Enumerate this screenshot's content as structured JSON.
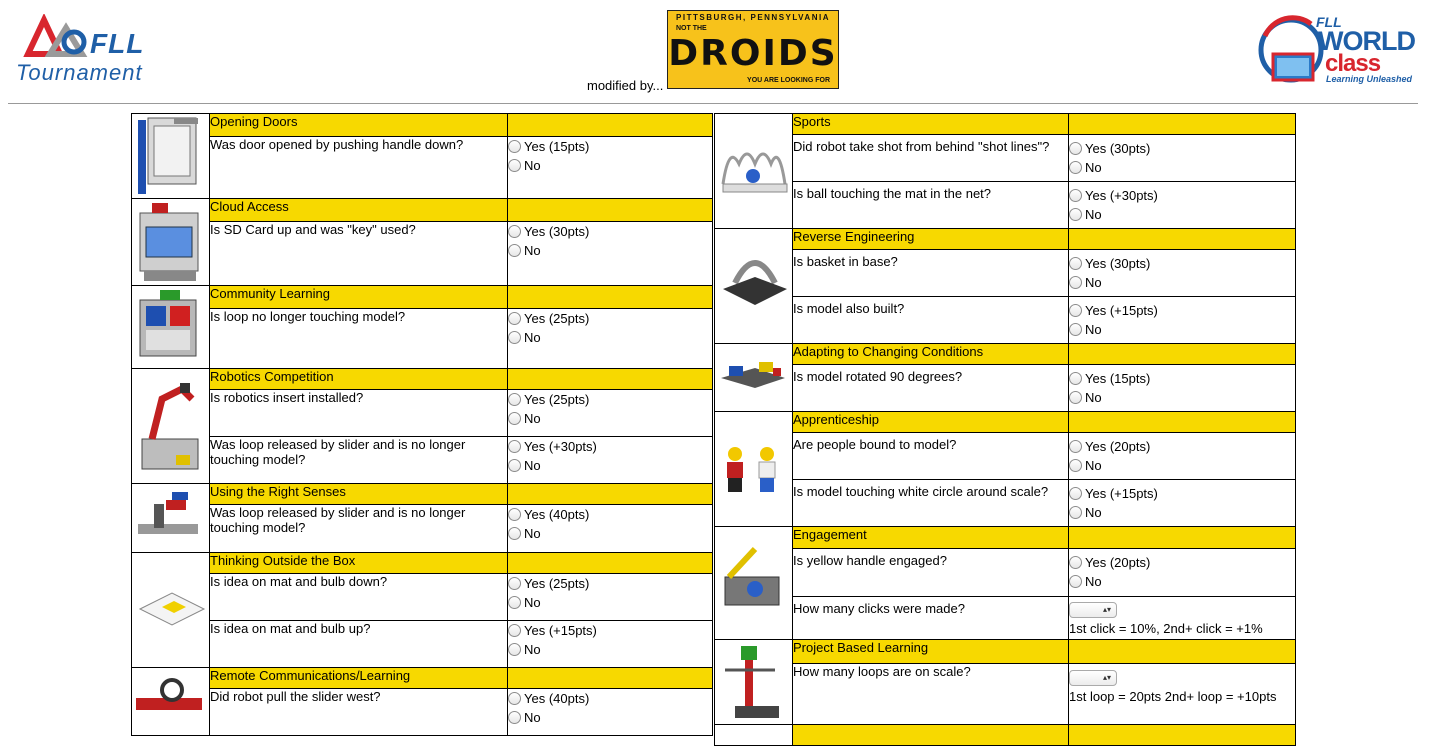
{
  "header": {
    "fll_logo_text": "FLL",
    "tournament_text": "Tournament",
    "modified_by": "modified by...",
    "droids": {
      "top_text": "PITTSBURGH, PENNSYLVANIA",
      "not_the": "NOT THE",
      "main_text": "DROIDS",
      "bottom_text": "YOU ARE LOOKING FOR"
    },
    "world_class": {
      "fll": "FLL",
      "world": "WORLD",
      "class": "class",
      "tagline": "Learning Unleashed"
    }
  },
  "left_missions": [
    {
      "title": "Opening Doors",
      "icon": "door-model-icon",
      "questions": [
        {
          "text": "Was door opened by pushing handle down?",
          "options": [
            "Yes (15pts)",
            "No"
          ]
        }
      ]
    },
    {
      "title": "Cloud Access",
      "icon": "cloud-access-model-icon",
      "questions": [
        {
          "text": "Is SD Card up and was \"key\" used?",
          "options": [
            "Yes (30pts)",
            "No"
          ]
        }
      ]
    },
    {
      "title": "Community Learning",
      "icon": "community-learning-model-icon",
      "questions": [
        {
          "text": "Is loop no longer touching model?",
          "options": [
            "Yes (25pts)",
            "No"
          ]
        }
      ]
    },
    {
      "title": "Robotics Competition",
      "icon": "robot-arm-model-icon",
      "questions": [
        {
          "text": "Is robotics insert installed?",
          "options": [
            "Yes (25pts)",
            "No"
          ]
        },
        {
          "text": "Was loop released by slider and is no longer touching model?",
          "options": [
            "Yes (+30pts)",
            "No"
          ]
        }
      ]
    },
    {
      "title": "Using the Right Senses",
      "icon": "senses-model-icon",
      "questions": [
        {
          "text": "Was loop released by slider and is no longer touching model?",
          "options": [
            "Yes (40pts)",
            "No"
          ]
        }
      ]
    },
    {
      "title": "Thinking Outside the Box",
      "icon": "box-model-icon",
      "questions": [
        {
          "text": "Is idea on mat and bulb down?",
          "options": [
            "Yes (25pts)",
            "No"
          ]
        },
        {
          "text": "Is idea on mat and bulb up?",
          "options": [
            "Yes (+15pts)",
            "No"
          ]
        }
      ]
    },
    {
      "title": "Remote Communications/Learning",
      "icon": "slider-model-icon",
      "questions": [
        {
          "text": "Did robot pull the slider west?",
          "options": [
            "Yes (40pts)",
            "No"
          ]
        }
      ]
    }
  ],
  "right_missions": [
    {
      "title": "Sports",
      "icon": "sports-net-model-icon",
      "questions": [
        {
          "text": "Did robot take shot from behind \"shot lines\"?",
          "options": [
            "Yes (30pts)",
            "No"
          ]
        },
        {
          "text": "Is ball touching the mat in the net?",
          "options": [
            "Yes (+30pts)",
            "No"
          ]
        }
      ]
    },
    {
      "title": "Reverse Engineering",
      "icon": "basket-model-icon",
      "questions": [
        {
          "text": "Is basket in base?",
          "options": [
            "Yes (30pts)",
            "No"
          ]
        },
        {
          "text": "Is model also built?",
          "options": [
            "Yes (+15pts)",
            "No"
          ]
        }
      ]
    },
    {
      "title": "Adapting to Changing Conditions",
      "icon": "adapting-model-icon",
      "questions": [
        {
          "text": "Is model rotated 90 degrees?",
          "options": [
            "Yes (15pts)",
            "No"
          ]
        }
      ]
    },
    {
      "title": "Apprenticeship",
      "icon": "minifigures-icon",
      "questions": [
        {
          "text": "Are people bound to model?",
          "options": [
            "Yes (20pts)",
            "No"
          ]
        },
        {
          "text": "Is model touching white circle around scale?",
          "options": [
            "Yes (+15pts)",
            "No"
          ]
        }
      ]
    },
    {
      "title": "Engagement",
      "icon": "engagement-model-icon",
      "questions": [
        {
          "text": "Is yellow handle engaged?",
          "options": [
            "Yes (20pts)",
            "No"
          ]
        },
        {
          "text": "How many clicks were made?",
          "select": "",
          "note": "1st click = 10%, 2nd+ click = +1%"
        }
      ]
    },
    {
      "title": "Project Based Learning",
      "icon": "scale-model-icon",
      "questions": [
        {
          "text": "How many loops are on scale?",
          "select": "",
          "note": "1st loop = 20pts 2nd+ loop = +10pts"
        }
      ]
    }
  ]
}
